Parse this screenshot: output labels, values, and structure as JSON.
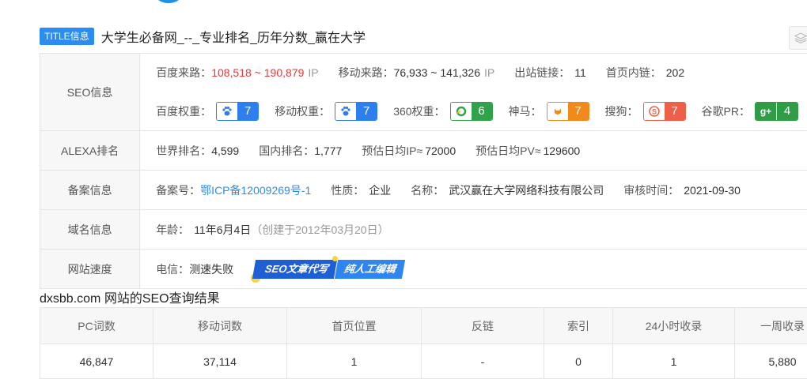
{
  "title": {
    "badge": "TITLE信息",
    "text": "大学生必备网_--_专业排名_历年分数_赢在大学"
  },
  "seo_info": {
    "label": "SEO信息",
    "baidu_traffic_label": "百度来路：",
    "baidu_traffic": "108,518 ~ 190,879",
    "baidu_traffic_unit": "IP",
    "mobile_traffic_label": "移动来路：",
    "mobile_traffic": "76,933 ~ 141,326",
    "mobile_traffic_unit": "IP",
    "outlinks_label": "出站链接：",
    "outlinks": "11",
    "homepage_links_label": "首页内链：",
    "homepage_links": "202",
    "weights": [
      {
        "label": "百度权重：",
        "icon": "paw-icon",
        "value": "7",
        "color": "#2d7ff0"
      },
      {
        "label": "移动权重：",
        "icon": "paw-icon",
        "value": "7",
        "color": "#2d7ff0"
      },
      {
        "label": "360权重：",
        "icon": "360-icon",
        "value": "6",
        "color": "#30a24a"
      },
      {
        "label": "神马：",
        "icon": "shenma-icon",
        "value": "7",
        "color": "#f08a1c"
      },
      {
        "label": "搜狗：",
        "icon": "sogou-icon",
        "value": "7",
        "color": "#ee5f49"
      },
      {
        "label": "谷歌PR：",
        "icon": "google-plus-icon",
        "value": "4",
        "color": "#2f9d46"
      }
    ]
  },
  "alexa": {
    "label": "ALEXA排名",
    "world_label": "世界排名：",
    "world": "4,599",
    "domestic_label": "国内排名：",
    "domestic": "1,777",
    "ip_label": "预估日均IP≈",
    "ip": "72000",
    "pv_label": "预估日均PV≈",
    "pv": "129600"
  },
  "icp": {
    "label": "备案信息",
    "number_label": "备案号：",
    "number": "鄂ICP备12009269号-1",
    "nature_label": "性质：",
    "nature": "企业",
    "name_label": "名称：",
    "name": "武汉赢在大学网络科技有限公司",
    "review_label": "审核时间：",
    "review": "2021-09-30"
  },
  "domain": {
    "label": "域名信息",
    "age_label": "年龄：",
    "age": "11年6月4日",
    "created": "（创建于2012年03月20日）"
  },
  "speed": {
    "label": "网站速度",
    "telecom_label": "电信：",
    "telecom": "测速失败",
    "promo_part1": "SEO文章代写",
    "promo_part2": "纯人工编辑"
  },
  "results": {
    "title": "dxsbb.com 网站的SEO查询结果",
    "headers": [
      "PC词数",
      "移动词数",
      "首页位置",
      "反链",
      "索引",
      "24小时收录",
      "一周收录"
    ],
    "values": [
      "46,847",
      "37,114",
      "1",
      "-",
      "0",
      "1",
      "5,880"
    ]
  },
  "colors": {
    "accent": "#2d8cf0",
    "red_value": "#e4393c"
  }
}
